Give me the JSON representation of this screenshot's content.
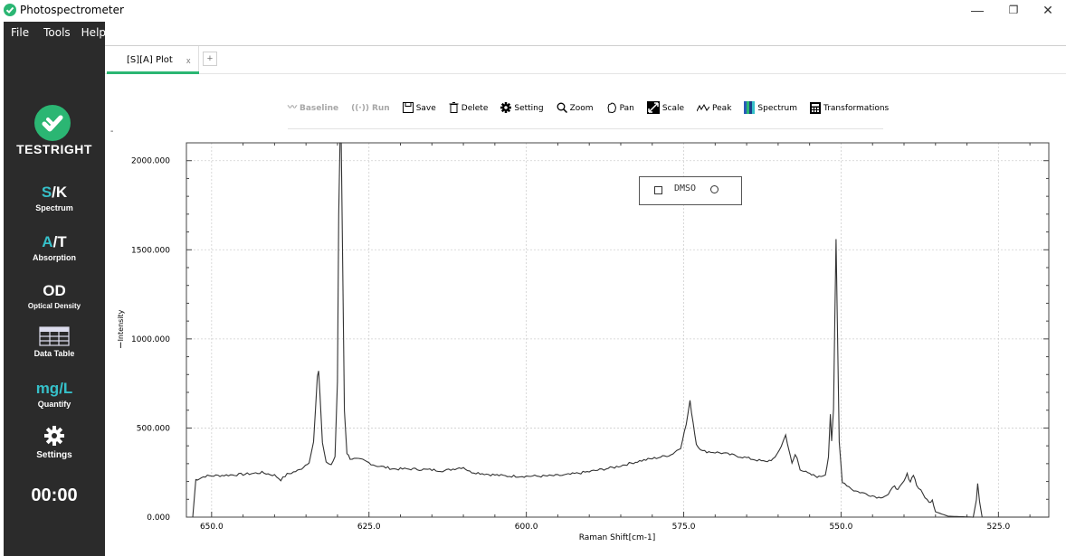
{
  "window": {
    "title": "Photospectrometer",
    "controls": {
      "minimize": "—",
      "restore": "❐",
      "close": "✕"
    }
  },
  "menu": {
    "items": [
      "File",
      "Tools",
      "Help"
    ]
  },
  "sidebar": {
    "brand": "TESTRIGHT",
    "items": [
      {
        "big_accent": "S",
        "big_rest": "/K",
        "label": "Spectrum"
      },
      {
        "big_accent": "A",
        "big_rest": "/T",
        "label": "Absorption"
      },
      {
        "big": "OD",
        "label": "Optical Density"
      },
      {
        "icon": "data-table-icon",
        "label": "Data Table"
      },
      {
        "big_teal": "mg/L",
        "label": "Quantify"
      },
      {
        "icon": "settings-gear-icon",
        "label": "Settings"
      }
    ],
    "timer": "00:00",
    "accent_color": "#36c0c9",
    "brand_color": "#2bb673"
  },
  "tabs": {
    "active": {
      "label": "[S][A] Plot",
      "close": "x"
    },
    "add": "+"
  },
  "toolbar": {
    "baseline": "Baseline",
    "run": "Run",
    "save": "Save",
    "delete": "Delete",
    "setting": "Setting",
    "zoom": "Zoom",
    "pan": "Pan",
    "scale": "Scale",
    "peak": "Peak",
    "spectrum": "Spectrum",
    "transformations": "Transformations"
  },
  "chart_data": {
    "type": "line",
    "xlabel": "Raman Shift[cm-1]",
    "ylabel": "Intensity",
    "xlim": [
      654,
      517
    ],
    "ylim": [
      0,
      2100
    ],
    "x_reversed": true,
    "x_ticks": [
      "650.0",
      "625.0",
      "600.0",
      "575.0",
      "550.0",
      "525.0"
    ],
    "x_tick_values": [
      650,
      625,
      600,
      575,
      550,
      525
    ],
    "y_ticks": [
      "0.000",
      "500.000",
      "1000.000",
      "1500.000",
      "2000.000"
    ],
    "y_tick_values": [
      0,
      500,
      1000,
      1500,
      2000
    ],
    "grid": true,
    "legend": {
      "entries": [
        "DMSO"
      ],
      "placement": "top-center"
    },
    "series": [
      {
        "name": "DMSO",
        "color": "#333333",
        "points": [
          [
            653.0,
            0
          ],
          [
            652.5,
            210
          ],
          [
            651.0,
            230
          ],
          [
            648.0,
            235
          ],
          [
            645.0,
            240
          ],
          [
            642.0,
            250
          ],
          [
            640.0,
            235
          ],
          [
            639.0,
            210
          ],
          [
            638.0,
            240
          ],
          [
            636.0,
            265
          ],
          [
            634.5,
            310
          ],
          [
            633.8,
            420
          ],
          [
            633.5,
            600
          ],
          [
            633.2,
            790
          ],
          [
            633.0,
            820
          ],
          [
            632.8,
            690
          ],
          [
            632.4,
            420
          ],
          [
            631.8,
            310
          ],
          [
            631.0,
            290
          ],
          [
            630.4,
            340
          ],
          [
            630.0,
            760
          ],
          [
            629.8,
            1700
          ],
          [
            629.6,
            2150
          ],
          [
            629.4,
            2150
          ],
          [
            629.2,
            1500
          ],
          [
            628.9,
            600
          ],
          [
            628.5,
            360
          ],
          [
            628.0,
            330
          ],
          [
            626.0,
            320
          ],
          [
            624.0,
            290
          ],
          [
            621.0,
            270
          ],
          [
            618.0,
            270
          ],
          [
            615.0,
            265
          ],
          [
            613.0,
            260
          ],
          [
            611.0,
            275
          ],
          [
            610.0,
            280
          ],
          [
            609.0,
            255
          ],
          [
            606.0,
            240
          ],
          [
            603.0,
            230
          ],
          [
            600.0,
            230
          ],
          [
            597.0,
            230
          ],
          [
            594.0,
            235
          ],
          [
            590.0,
            255
          ],
          [
            586.0,
            280
          ],
          [
            582.0,
            315
          ],
          [
            579.0,
            335
          ],
          [
            577.0,
            350
          ],
          [
            575.5,
            390
          ],
          [
            574.6,
            520
          ],
          [
            574.0,
            650
          ],
          [
            573.5,
            530
          ],
          [
            573.0,
            410
          ],
          [
            572.0,
            370
          ],
          [
            569.0,
            360
          ],
          [
            566.0,
            340
          ],
          [
            562.0,
            310
          ],
          [
            560.5,
            330
          ],
          [
            559.5,
            400
          ],
          [
            558.8,
            460
          ],
          [
            558.3,
            380
          ],
          [
            557.8,
            300
          ],
          [
            557.3,
            350
          ],
          [
            557.0,
            330
          ],
          [
            556.5,
            270
          ],
          [
            555.0,
            240
          ],
          [
            553.5,
            225
          ],
          [
            552.5,
            240
          ],
          [
            552.0,
            340
          ],
          [
            551.7,
            580
          ],
          [
            551.5,
            420
          ],
          [
            551.2,
            600
          ],
          [
            551.0,
            1100
          ],
          [
            550.8,
            1560
          ],
          [
            550.6,
            1100
          ],
          [
            550.3,
            420
          ],
          [
            549.8,
            200
          ],
          [
            548.0,
            150
          ],
          [
            546.0,
            130
          ],
          [
            544.0,
            110
          ],
          [
            542.5,
            125
          ],
          [
            541.5,
            180
          ],
          [
            541.0,
            150
          ],
          [
            540.0,
            200
          ],
          [
            539.5,
            240
          ],
          [
            539.0,
            200
          ],
          [
            538.5,
            240
          ],
          [
            538.0,
            180
          ],
          [
            537.0,
            130
          ],
          [
            536.0,
            80
          ],
          [
            535.5,
            100
          ],
          [
            535.0,
            30
          ],
          [
            533.0,
            5
          ],
          [
            529.0,
            0
          ],
          [
            528.5,
            100
          ],
          [
            528.3,
            195
          ],
          [
            528.0,
            90
          ],
          [
            527.6,
            0
          ],
          [
            522.0,
            0
          ],
          [
            517.0,
            0
          ]
        ]
      }
    ]
  }
}
